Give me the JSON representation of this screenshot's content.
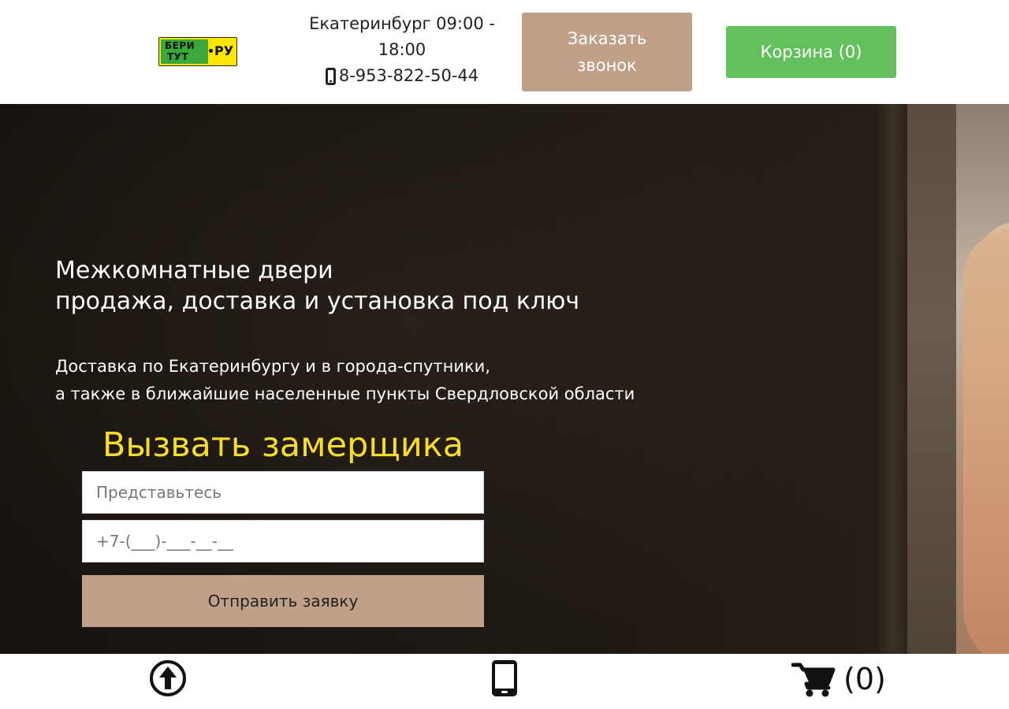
{
  "logo": {
    "line1": "БЕРИ",
    "line2": "ТУТ",
    "suffix": "РУ"
  },
  "header": {
    "city_hours": "Екатеринбург 09:00 - 18:00",
    "phone": "8-953-822-50-44",
    "callback_label": "Заказать звонок",
    "cart_label": "Корзина (0)"
  },
  "hero": {
    "title_line1": "Межкомнатные двери",
    "title_line2": "продажа, доставка и установка под ключ",
    "sub_line1": "Доставка по Екатеринбургу и в города-спутники,",
    "sub_line2": "а также в ближайшие населенные пункты Свердловской области"
  },
  "form": {
    "title": "Вызвать замерщика",
    "name_placeholder": "Представьтесь",
    "phone_placeholder": "+7-(___)-___-__-__",
    "submit_label": "Отправить заявку"
  },
  "bottom_bar": {
    "cart_count": "(0)",
    "icons": [
      "arrow-up-circle-icon",
      "mobile-phone-icon",
      "shopping-cart-icon"
    ]
  },
  "colors": {
    "accent_beige": "#c0a088",
    "cart_green": "#62c15d",
    "form_title_yellow": "#f7dc2a",
    "logo_yellow": "#ffe600",
    "logo_green": "#3ba83b"
  }
}
